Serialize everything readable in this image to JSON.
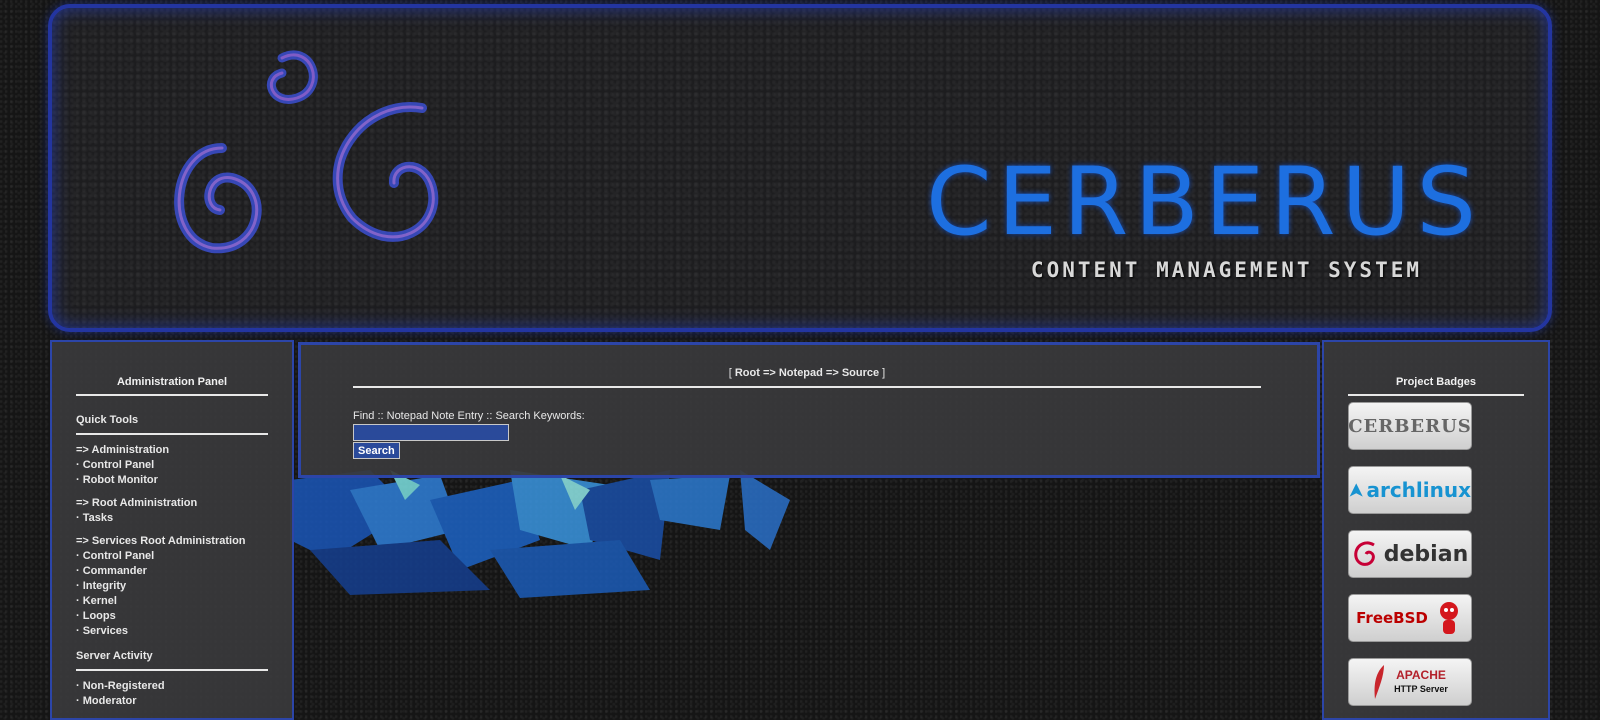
{
  "banner": {
    "brand": "CERBERUS",
    "tagline": "CONTENT MANAGEMENT SYSTEM"
  },
  "left_panel": {
    "title": "Administration Panel",
    "quick_tools_title": "Quick Tools",
    "groups": [
      {
        "heading": "=> Administration",
        "items": [
          "· Control Panel",
          "· Robot Monitor"
        ]
      },
      {
        "heading": "=> Root Administration",
        "items": [
          "· Tasks"
        ]
      },
      {
        "heading": "=> Services Root Administration",
        "items": [
          "· Control Panel",
          "· Commander",
          "· Integrity",
          "· Kernel",
          "· Loops",
          "· Services"
        ]
      }
    ],
    "server_activity_title": "Server Activity",
    "activity_items": [
      "· Non-Registered",
      "· Moderator"
    ]
  },
  "center_panel": {
    "breadcrumb_open": "[ ",
    "breadcrumb": "Root => Notepad => Source",
    "breadcrumb_close": " ]",
    "search_label": "Find :: Notepad Note Entry :: Search Keywords:",
    "search_value": "",
    "search_button": "Search"
  },
  "right_panel": {
    "title": "Project Badges",
    "badges": [
      {
        "name": "cerberus-badge",
        "text": "CERBERUS"
      },
      {
        "name": "archlinux-badge",
        "text": "archlinux"
      },
      {
        "name": "debian-badge",
        "text": "debian"
      },
      {
        "name": "freebsd-badge",
        "text": "FreeBSD"
      },
      {
        "name": "apache-badge",
        "text": "APACHE",
        "sub": "HTTP Server"
      }
    ]
  },
  "colors": {
    "accent_border": "#2c45a8",
    "brand_blue": "#1d6fe0",
    "input_bg": "#2a4a9a"
  }
}
